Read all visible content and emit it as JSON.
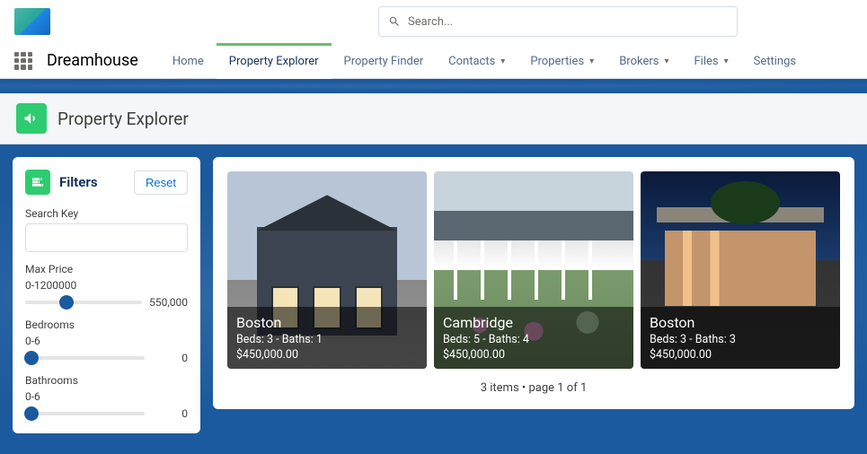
{
  "header": {
    "search_placeholder": "Search..."
  },
  "nav": {
    "app_name": "Dreamhouse",
    "tabs": [
      {
        "label": "Home",
        "has_chevron": false,
        "active": false
      },
      {
        "label": "Property Explorer",
        "has_chevron": false,
        "active": true
      },
      {
        "label": "Property Finder",
        "has_chevron": false,
        "active": false
      },
      {
        "label": "Contacts",
        "has_chevron": true,
        "active": false
      },
      {
        "label": "Properties",
        "has_chevron": true,
        "active": false
      },
      {
        "label": "Brokers",
        "has_chevron": true,
        "active": false
      },
      {
        "label": "Files",
        "has_chevron": true,
        "active": false
      },
      {
        "label": "Settings",
        "has_chevron": false,
        "active": false
      }
    ]
  },
  "page": {
    "title": "Property Explorer"
  },
  "filters": {
    "title": "Filters",
    "reset_label": "Reset",
    "search_key_label": "Search Key",
    "search_key_value": "",
    "max_price": {
      "label": "Max Price",
      "range": "0-1200000",
      "value": "550,000",
      "percent": 35
    },
    "bedrooms": {
      "label": "Bedrooms",
      "range": "0-6",
      "value": "0",
      "percent": 0
    },
    "bathrooms": {
      "label": "Bathrooms",
      "range": "0-6",
      "value": "0",
      "percent": 0
    }
  },
  "results": {
    "pager": "3 items • page 1 of 1",
    "cards": [
      {
        "city": "Boston",
        "meta": "Beds: 3 - Baths: 1",
        "price": "$450,000.00"
      },
      {
        "city": "Cambridge",
        "meta": "Beds: 5 - Baths: 4",
        "price": "$450,000.00"
      },
      {
        "city": "Boston",
        "meta": "Beds: 3 - Baths: 3",
        "price": "$450,000.00"
      }
    ]
  }
}
